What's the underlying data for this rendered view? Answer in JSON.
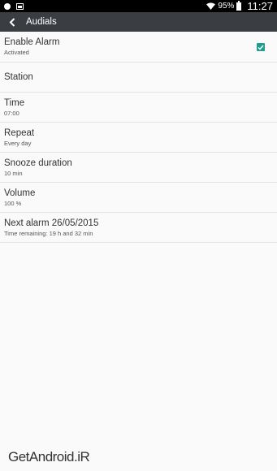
{
  "status_bar": {
    "battery": "95%",
    "time": "11:27",
    "icons": [
      "notification-dot-icon",
      "image-icon",
      "wifi-icon",
      "battery-icon"
    ]
  },
  "action_bar": {
    "title": "Audials",
    "back_icon": "chevron-left-icon"
  },
  "settings": [
    {
      "title": "Enable Alarm",
      "subtitle": "Activated",
      "checkbox": true
    },
    {
      "title": "Station",
      "subtitle": ""
    },
    {
      "title": "Time",
      "subtitle": "07:00"
    },
    {
      "title": "Repeat",
      "subtitle": "Every day"
    },
    {
      "title": "Snooze duration",
      "subtitle": "10 min"
    },
    {
      "title": "Volume",
      "subtitle": "100 %"
    },
    {
      "title": "Next alarm 26/05/2015",
      "subtitle": "Time remaining: 19 h and 32 min"
    }
  ],
  "watermark": "GetAndroid.iR",
  "colors": {
    "status_bar": "#000000",
    "action_bar": "#3a3d42",
    "checkbox": "#1e9e8e",
    "background": "#fafafa"
  }
}
